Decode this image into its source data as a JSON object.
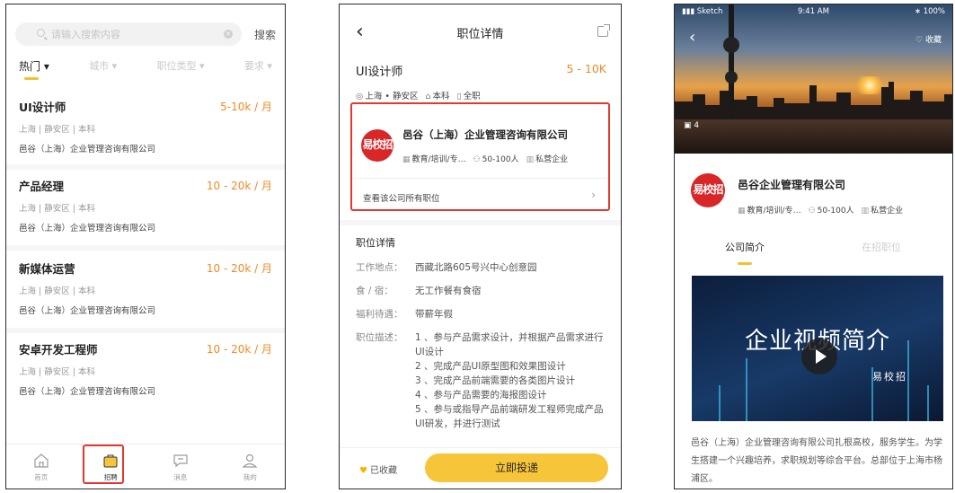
{
  "screen1": {
    "search_placeholder": "请输入搜索内容",
    "search_button": "搜索",
    "filters": [
      "热门 ▾",
      "城市 ▾",
      "职位类型 ▾",
      "要求 ▾"
    ],
    "jobs": [
      {
        "title": "UI设计师",
        "salary": "5-10k / 月",
        "location": "上海 | 静安区 | 本科",
        "company": "邑谷（上海）企业管理咨询有限公司"
      },
      {
        "title": "产品经理",
        "salary": "10 - 20k / 月",
        "location": "上海 | 静安区 | 本科",
        "company": "邑谷（上海）企业管理咨询有限公司"
      },
      {
        "title": "新媒体运营",
        "salary": "10 - 20k / 月",
        "location": "上海 | 静安区 | 本科",
        "company": "邑谷（上海）企业管理咨询有限公司"
      },
      {
        "title": "安卓开发工程师",
        "salary": "10 - 20k / 月",
        "location": "上海 | 静安区 | 本科",
        "company": "邑谷（上海）企业管理咨询有限公司"
      }
    ],
    "tabs": [
      {
        "label": "首页",
        "icon": "home-icon"
      },
      {
        "label": "招聘",
        "icon": "briefcase-icon"
      },
      {
        "label": "消息",
        "icon": "message-icon"
      },
      {
        "label": "我的",
        "icon": "profile-icon"
      }
    ]
  },
  "screen2": {
    "nav_title": "职位详情",
    "position_title": "UI设计师",
    "salary": "5 - 10K",
    "meta": [
      "上海 • 静安区",
      "本科",
      "全职"
    ],
    "company": {
      "logo_text": "易校招",
      "name": "邑谷（上海）企业管理咨询有限公司",
      "industry": "教育/培训/专…",
      "size": "50-100人",
      "type": "私营企业",
      "all_jobs_link": "查看该公司所有职位"
    },
    "details_heading": "职位详情",
    "details": [
      {
        "label": "工作地点：",
        "value": "西藏北路605号兴中心创意园"
      },
      {
        "label": "食 / 宿：",
        "value": "无工作餐有食宿"
      },
      {
        "label": "福利待遇：",
        "value": "带薪年假"
      }
    ],
    "desc_label": "职位描述：",
    "desc_lines": [
      "1 、参与产品需求设计，并根据产品需求进行UI设计",
      "2 、完成产品UI原型图和效果图设计",
      "3 、完成产品前端需要的各类图片设计",
      "4 、参与产品需要的海报图设计",
      "5 、参与或指导产品前端研发工程师完成产品UI研发，并进行测试"
    ],
    "favorited_label": "已收藏",
    "apply_button": "立即投递"
  },
  "screen3": {
    "status": {
      "carrier": "Sketch",
      "time": "9:41 AM",
      "battery": "100%"
    },
    "favorite_label": "收藏",
    "photo_count": "4",
    "company": {
      "logo_text": "易校招",
      "name": "邑谷企业管理有限公司",
      "industry": "教育/培训/专…",
      "size": "50-100人",
      "type": "私营企业"
    },
    "tabs": [
      "公司简介",
      "在招职位"
    ],
    "video_title": "企业视频简介",
    "video_brand": "易校招",
    "intro": "邑谷（上海）企业管理咨询有限公司扎根高校，服务学生。为学生搭建一个兴趣培养，求职规划等综合平台。总部位于上海市杨浦区。"
  },
  "colors": {
    "accent": "#f7c53a",
    "salary": "#f08a24",
    "highlight": "#e8352c",
    "logo": "#d92626"
  }
}
